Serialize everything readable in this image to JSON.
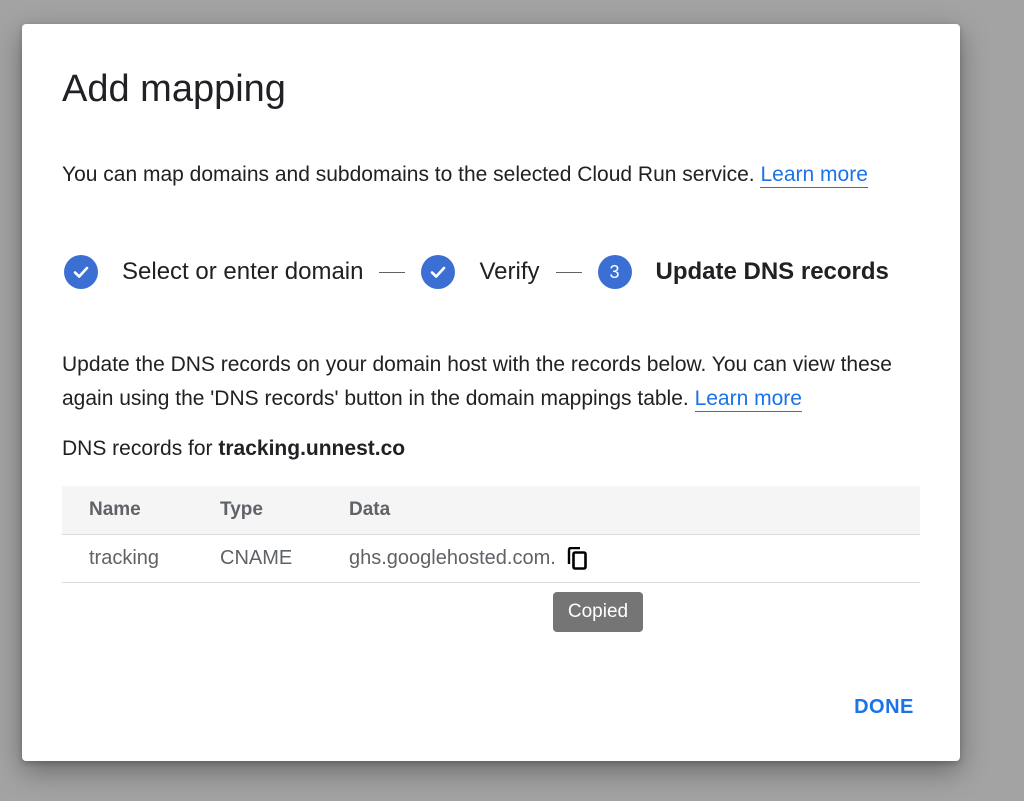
{
  "dialog": {
    "title": "Add mapping",
    "intro_text": "You can map domains and subdomains to the selected Cloud Run service. ",
    "intro_link": "Learn more"
  },
  "stepper": {
    "steps": [
      {
        "label": "Select or enter domain",
        "status": "complete",
        "icon": "check-icon"
      },
      {
        "label": "Verify",
        "status": "complete",
        "icon": "check-icon"
      },
      {
        "label": "Update DNS records",
        "status": "active",
        "number": "3"
      }
    ],
    "accent_color": "#3b6fd4"
  },
  "description": {
    "text": "Update the DNS records on your domain host with the records below. You can view these again using the 'DNS records' button in the domain mappings table. ",
    "link": "Learn more"
  },
  "records": {
    "prefix": "DNS records for ",
    "domain": "tracking.unnest.co"
  },
  "table": {
    "headers": [
      "Name",
      "Type",
      "Data"
    ],
    "rows": [
      {
        "name": "tracking",
        "type": "CNAME",
        "data": "ghs.googlehosted.com."
      }
    ]
  },
  "tooltip": "Copied",
  "actions": {
    "done_label": "DONE"
  },
  "colors": {
    "link": "#1a73e8",
    "overlay": "#a3a3a3"
  }
}
